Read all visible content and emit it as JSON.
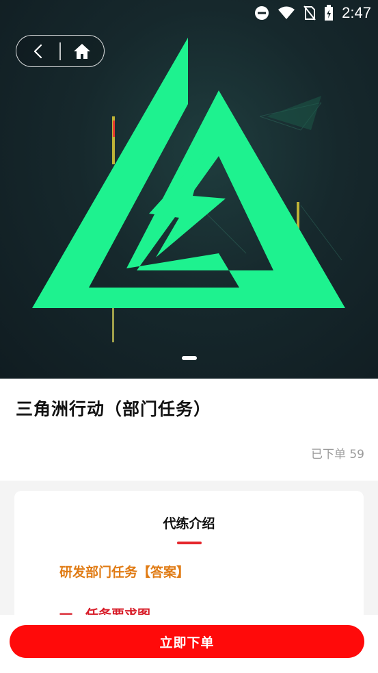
{
  "status_bar": {
    "time": "2:47",
    "icons": [
      "do-not-disturb-icon",
      "wifi-icon",
      "no-sim-icon",
      "battery-icon"
    ]
  },
  "nav": {
    "back_icon": "back-arrow-icon",
    "home_icon": "home-icon"
  },
  "banner": {
    "slides": 1,
    "active_slide": 1,
    "accent_color": "#1ef28f"
  },
  "product": {
    "title": "三角洲行动（部门任务）",
    "sold": "已下单 59"
  },
  "intro": {
    "tab": "代练介绍",
    "heading": "研发部门任务【答案】",
    "subheading": "一、任务要求图"
  },
  "actions": {
    "order": "立即下单"
  },
  "colors": {
    "primary": "#ff0a0a",
    "accent_orange": "#e07b14",
    "accent_red": "#d81e2a"
  }
}
